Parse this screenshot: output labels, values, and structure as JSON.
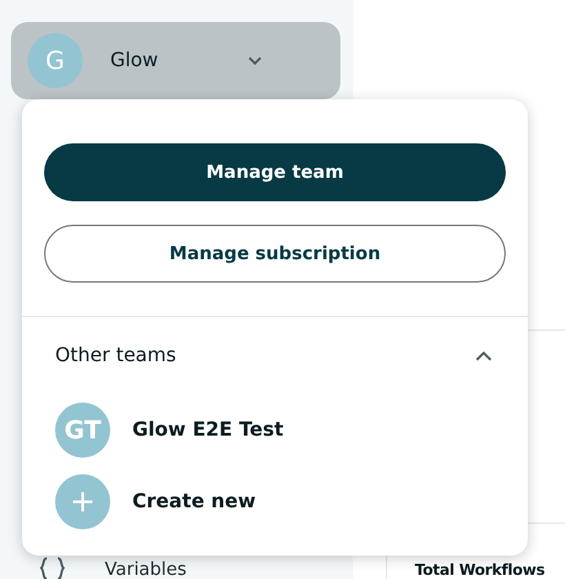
{
  "team_switcher": {
    "initial": "G",
    "name": "Glow",
    "expanded": true
  },
  "menu": {
    "primary_button": "Manage team",
    "secondary_button": "Manage subscription",
    "other_teams": {
      "label": "Other teams",
      "expanded": true,
      "teams": [
        {
          "initials": "GT",
          "name": "Glow E2E Test"
        }
      ]
    },
    "create_label": "Create new"
  },
  "sidebar": {
    "items": [
      {
        "label": "Variables"
      }
    ]
  },
  "main": {
    "card_title": "Total Workflows"
  }
}
